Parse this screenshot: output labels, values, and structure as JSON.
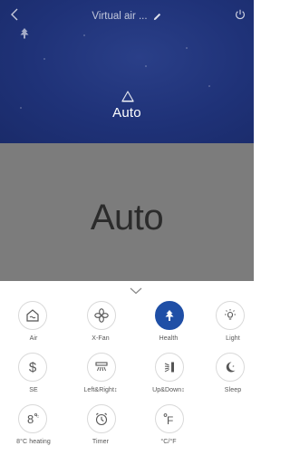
{
  "header": {
    "title": "Virtual air ...",
    "mode_label": "Auto"
  },
  "display": {
    "mode_text": "Auto"
  },
  "controls": [
    {
      "label": "Air",
      "icon": "air-icon",
      "active": false
    },
    {
      "label": "X-Fan",
      "icon": "fan-icon",
      "active": false
    },
    {
      "label": "Health",
      "icon": "health-icon",
      "active": true
    },
    {
      "label": "Light",
      "icon": "light-icon",
      "active": false
    },
    {
      "label": "SE",
      "icon": "dollar-icon",
      "active": false
    },
    {
      "label": "Left&Right↕",
      "icon": "swing-horizontal-icon",
      "active": false
    },
    {
      "label": "Up&Down↕",
      "icon": "swing-vertical-icon",
      "active": false
    },
    {
      "label": "Sleep",
      "icon": "sleep-icon",
      "active": false
    },
    {
      "label": "8°C heating",
      "icon": "eight-degree-icon",
      "active": false
    },
    {
      "label": "Timer",
      "icon": "timer-icon",
      "active": false
    },
    {
      "label": "°C/°F",
      "icon": "temperature-unit-icon",
      "active": false
    }
  ],
  "colors": {
    "header_bg": "#1f3278",
    "display_bg": "#7c7c7c",
    "active_accent": "#1f4fa6"
  }
}
